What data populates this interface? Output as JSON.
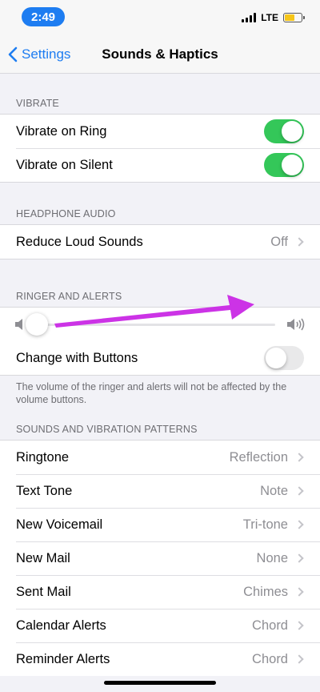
{
  "status_bar": {
    "time": "2:49",
    "network": "LTE",
    "battery_color": "#f5c518"
  },
  "nav": {
    "back_label": "Settings",
    "title": "Sounds & Haptics"
  },
  "vibrate": {
    "header": "VIBRATE",
    "ring": {
      "label": "Vibrate on Ring",
      "on": true
    },
    "silent": {
      "label": "Vibrate on Silent",
      "on": true
    }
  },
  "headphone": {
    "header": "HEADPHONE AUDIO",
    "reduce": {
      "label": "Reduce Loud Sounds",
      "value": "Off"
    }
  },
  "ringer": {
    "header": "RINGER AND ALERTS",
    "volume_level": 0.0,
    "change_with_buttons": {
      "label": "Change with Buttons",
      "on": false
    },
    "footnote": "The volume of the ringer and alerts will not be affected by the volume buttons."
  },
  "patterns": {
    "header": "SOUNDS AND VIBRATION PATTERNS",
    "items": [
      {
        "label": "Ringtone",
        "value": "Reflection"
      },
      {
        "label": "Text Tone",
        "value": "Note"
      },
      {
        "label": "New Voicemail",
        "value": "Tri-tone"
      },
      {
        "label": "New Mail",
        "value": "None"
      },
      {
        "label": "Sent Mail",
        "value": "Chimes"
      },
      {
        "label": "Calendar Alerts",
        "value": "Chord"
      },
      {
        "label": "Reminder Alerts",
        "value": "Chord"
      }
    ]
  },
  "colors": {
    "accent": "#1e7df1",
    "toggle_on": "#34c759",
    "annotation_arrow": "#cc33e6"
  }
}
